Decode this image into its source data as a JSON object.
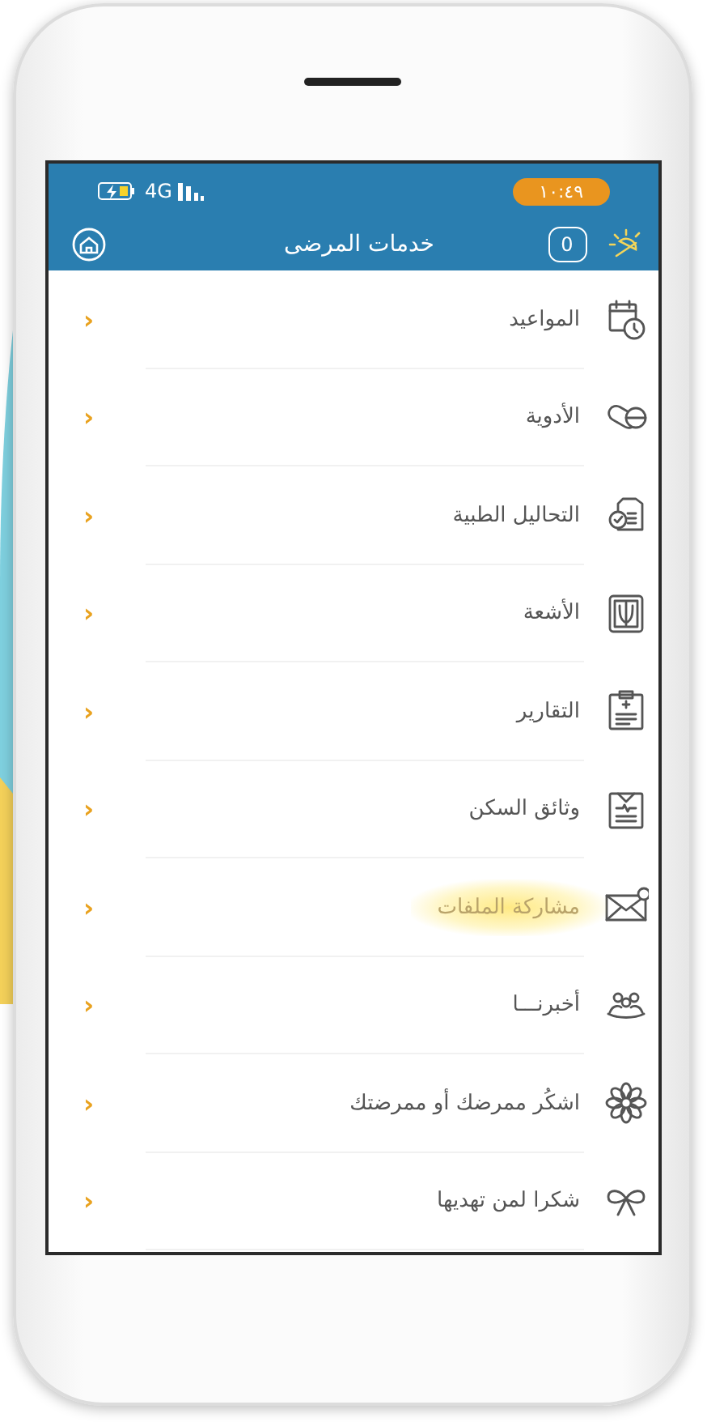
{
  "status_bar": {
    "network": "4G",
    "time": "١٠:٤٩"
  },
  "header": {
    "title": "خدمات المرضى",
    "count": "0"
  },
  "menu": [
    {
      "label": "المواعيد",
      "selected": false,
      "chevron": "‹"
    },
    {
      "label": "الأدوية",
      "selected": false,
      "chevron": "‹"
    },
    {
      "label": "التحاليل الطبية",
      "selected": false,
      "chevron": "‹"
    },
    {
      "label": "الأشعة",
      "selected": false,
      "chevron": "‹"
    },
    {
      "label": "التقارير",
      "selected": false,
      "chevron": "‹"
    },
    {
      "label": "وثائق السكن",
      "selected": false,
      "chevron": "‹"
    },
    {
      "label": "مشاركة الملفات",
      "selected": true,
      "chevron": "‹"
    },
    {
      "label": "أخبرنـــا",
      "selected": false,
      "chevron": "‹"
    },
    {
      "label": "اشكُر ممرضك أو ممرضتك",
      "selected": false,
      "chevron": "‹"
    },
    {
      "label": "شكرا لمن تهديها",
      "selected": false,
      "chevron": "‹"
    }
  ]
}
